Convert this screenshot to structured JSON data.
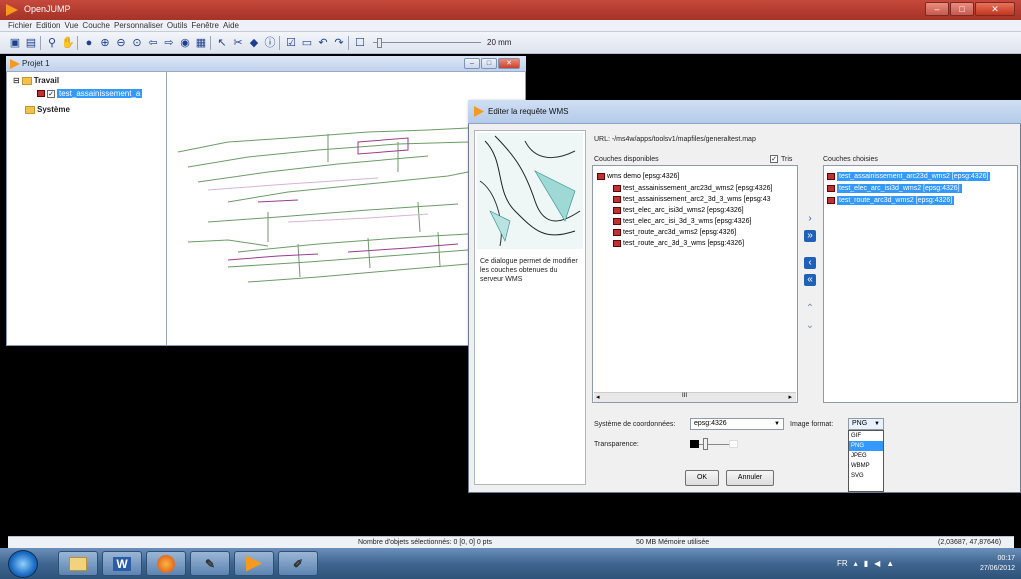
{
  "app": {
    "title": "OpenJUMP"
  },
  "menu": [
    "Fichier",
    "Edition",
    "Vue",
    "Couche",
    "Personnaliser",
    "Outils",
    "Fenêtre",
    "Aide"
  ],
  "toolbar": {
    "scale_label": "20 mm"
  },
  "project": {
    "title": "Projet 1",
    "tree": {
      "group1": "Travail",
      "layer1": "test_assainissement_a",
      "group2": "Système"
    }
  },
  "status": {
    "selection": "Nombre d'objets sélectionnés: 0 [0, 0] 0 pts",
    "memory": "50 MB Mémoire utilisée",
    "coords": "(2,03687, 47,87646)"
  },
  "taskbar": {
    "lang": "FR",
    "time": "00:17",
    "date": "27/06/2012"
  },
  "dialog": {
    "title": "Editer la requête WMS",
    "url": "URL: -/ms4w/apps/toolsv1/mapfiles/generaltest.map",
    "description": "Ce dialogue permet de modifier les couches obtenues du serveur WMS",
    "available_label": "Couches disponibles",
    "sort_label": "Tris",
    "sort_checked": true,
    "chosen_label": "Couches choisies",
    "available_root": "wms demo [epsg:4326]",
    "available_layers": [
      "test_assainissement_arc23d_wms2 [epsg:4326]",
      "test_assainissement_arc2_3d_3_wms [epsg:43",
      "test_elec_arc_isi3d_wms2 [epsg:4326]",
      "test_elec_arc_isi_3d_3_wms [epsg:4326]",
      "test_route_arc3d_wms2 [epsg:4326]",
      "test_route_arc_3d_3_wms [epsg:4326]"
    ],
    "chosen_layers": [
      "test_assainissement_arc23d_wms2 [epsg:4326]",
      "test_elec_arc_isi3d_wms2 [epsg:4326]",
      "test_route_arc3d_wms2 [epsg:4326]"
    ],
    "crs_label": "Système de coordonnées:",
    "crs_value": "epsg:4326",
    "format_label": "Image format:",
    "format_value": "PNG",
    "format_options": [
      "GIF",
      "PNG",
      "JPEG",
      "WBMP",
      "SVG"
    ],
    "transparency_label": "Transparence:",
    "ok_label": "OK",
    "cancel_label": "Annuler",
    "scroll_thumb": "III"
  }
}
